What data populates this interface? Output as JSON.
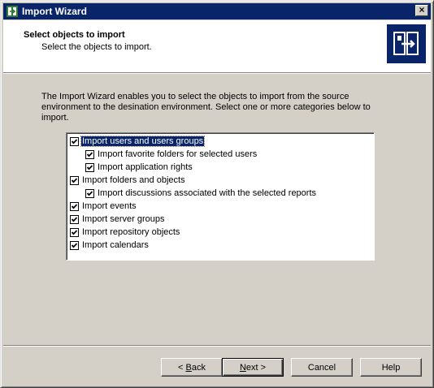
{
  "window": {
    "title": "Import Wizard",
    "close_label": "×"
  },
  "header": {
    "title": "Select objects to import",
    "subtitle": "Select the objects to import."
  },
  "description": "The Import Wizard enables you to select the objects to import from the source environment to the desination environment. Select one or more categories below to import.",
  "tree": {
    "items": [
      {
        "label": "Import users and users groups",
        "checked": true,
        "level": 0,
        "selected": true
      },
      {
        "label": "Import favorite folders for selected users",
        "checked": true,
        "level": 1
      },
      {
        "label": "Import application rights",
        "checked": true,
        "level": 1
      },
      {
        "label": "Import folders and objects",
        "checked": true,
        "level": 0
      },
      {
        "label": "Import discussions associated with the selected reports",
        "checked": true,
        "level": 1
      },
      {
        "label": "Import events",
        "checked": true,
        "level": 0
      },
      {
        "label": "Import server groups",
        "checked": true,
        "level": 0
      },
      {
        "label": "Import repository objects",
        "checked": true,
        "level": 0
      },
      {
        "label": "Import calendars",
        "checked": true,
        "level": 0
      }
    ]
  },
  "buttons": {
    "back": {
      "prefix": "< ",
      "mnemonic": "B",
      "rest": "ack"
    },
    "next": {
      "mnemonic": "N",
      "rest": "ext >"
    },
    "cancel": "Cancel",
    "help": "Help"
  }
}
